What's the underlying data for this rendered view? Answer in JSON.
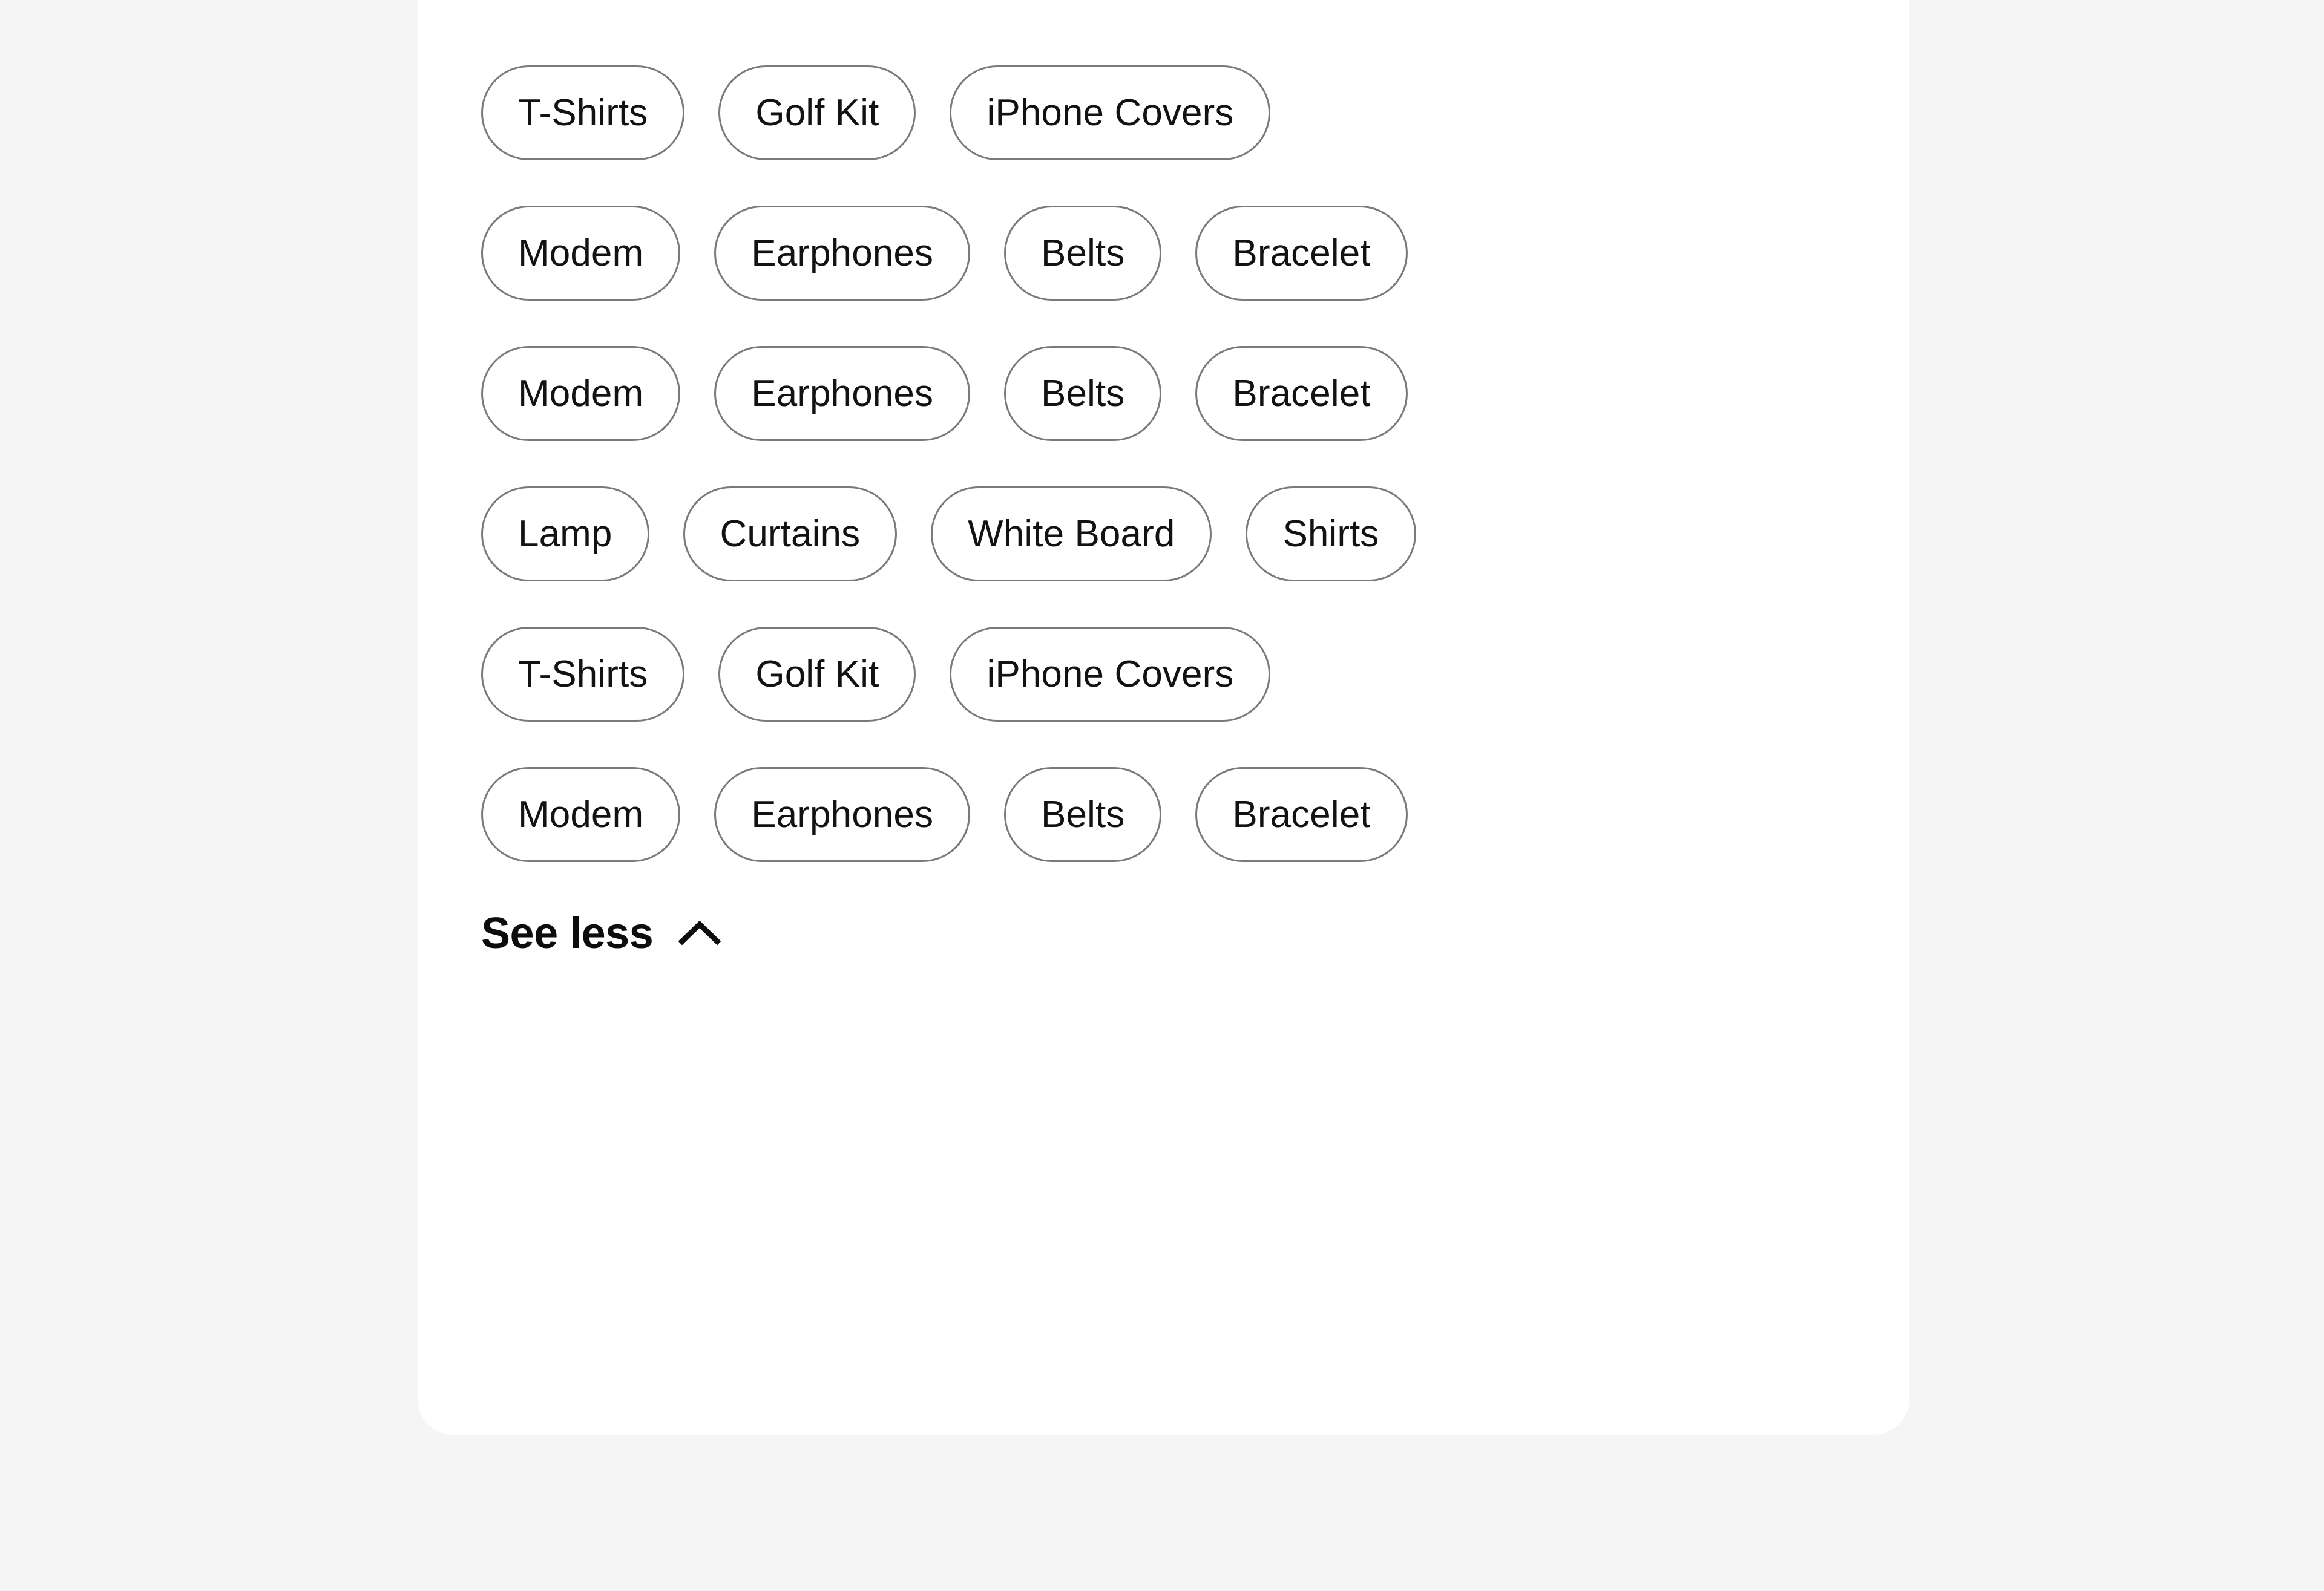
{
  "page": {
    "background_color": "#f5f5f5"
  },
  "card": {
    "background_color": "#ffffff",
    "corner_radius_px": 60
  },
  "category_filter": {
    "chip_border_color": "#7a7a7a",
    "chip_text_color": "#121212",
    "rows": [
      {
        "chips": [
          {
            "label": "T-Shirts"
          },
          {
            "label": "Golf Kit"
          },
          {
            "label": "iPhone Covers"
          }
        ]
      },
      {
        "chips": [
          {
            "label": "Modem"
          },
          {
            "label": "Earphones"
          },
          {
            "label": "Belts"
          },
          {
            "label": "Bracelet"
          }
        ]
      },
      {
        "chips": [
          {
            "label": "Modem"
          },
          {
            "label": "Earphones"
          },
          {
            "label": "Belts"
          },
          {
            "label": "Bracelet"
          }
        ]
      },
      {
        "chips": [
          {
            "label": "Lamp"
          },
          {
            "label": "Curtains"
          },
          {
            "label": "White Board"
          },
          {
            "label": "Shirts"
          }
        ]
      },
      {
        "chips": [
          {
            "label": "T-Shirts"
          },
          {
            "label": "Golf Kit"
          },
          {
            "label": "iPhone Covers"
          }
        ]
      },
      {
        "chips": [
          {
            "label": "Modem"
          },
          {
            "label": "Earphones"
          },
          {
            "label": "Belts"
          },
          {
            "label": "Bracelet"
          }
        ]
      }
    ],
    "toggle": {
      "label": "See less",
      "icon": "chevron-up-icon",
      "expanded": true
    }
  }
}
